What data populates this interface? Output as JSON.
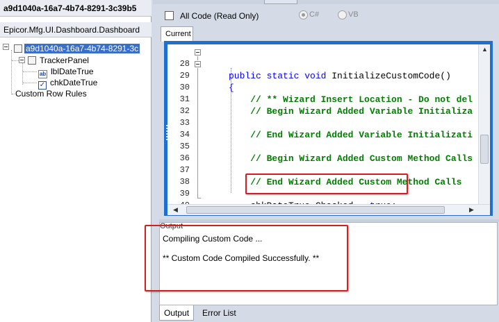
{
  "left_pane": {
    "header_id": "a9d1040a-16a7-4b74-8291-3c39b5",
    "namespace": "Epicor.Mfg.UI.Dashboard.Dashboard",
    "tree": [
      {
        "label": "a9d1040a-16a7-4b74-8291-3c",
        "selected": true
      },
      {
        "label": "TrackerPanel"
      },
      {
        "label": "lblDateTrue",
        "icon": "label-icon"
      },
      {
        "label": "chkDateTrue",
        "icon": "checkbox-icon"
      },
      {
        "label": "Custom Row Rules"
      }
    ]
  },
  "options": {
    "all_code_label": "All Code (Read Only)",
    "lang_cs": "C#",
    "lang_vb": "VB"
  },
  "editor_tabs": {
    "current": "Current"
  },
  "code_lines": [
    {
      "num": "28",
      "text": "public static void InitializeCustomCode()"
    },
    {
      "num": "29",
      "text": "{"
    },
    {
      "num": "30",
      "text": "    // ** Wizard Insert Location - Do not del"
    },
    {
      "num": "31",
      "text": "    // Begin Wizard Added Variable Initializa"
    },
    {
      "num": "32",
      "text": ""
    },
    {
      "num": "33",
      "text": "    // End Wizard Added Variable Initializati"
    },
    {
      "num": "34",
      "text": ""
    },
    {
      "num": "35",
      "text": "    // Begin Wizard Added Custom Method Calls"
    },
    {
      "num": "36",
      "text": ""
    },
    {
      "num": "37",
      "text": "    // End Wizard Added Custom Method Calls"
    },
    {
      "num": "38",
      "text": ""
    },
    {
      "num": "39",
      "text": "    chkDateTrue.Checked = true;"
    },
    {
      "num": "40",
      "text": "}"
    }
  ],
  "output": {
    "title": "Output",
    "line1": "Compiling Custom Code ...",
    "line2": "** Custom Code Compiled Successfully. **"
  },
  "bottom_tabs": {
    "output": "Output",
    "error_list": "Error List"
  },
  "colors": {
    "keyword": "#0000ff",
    "comment": "#008000",
    "highlight": "#d21f1f",
    "selection": "#3a6fc8"
  }
}
